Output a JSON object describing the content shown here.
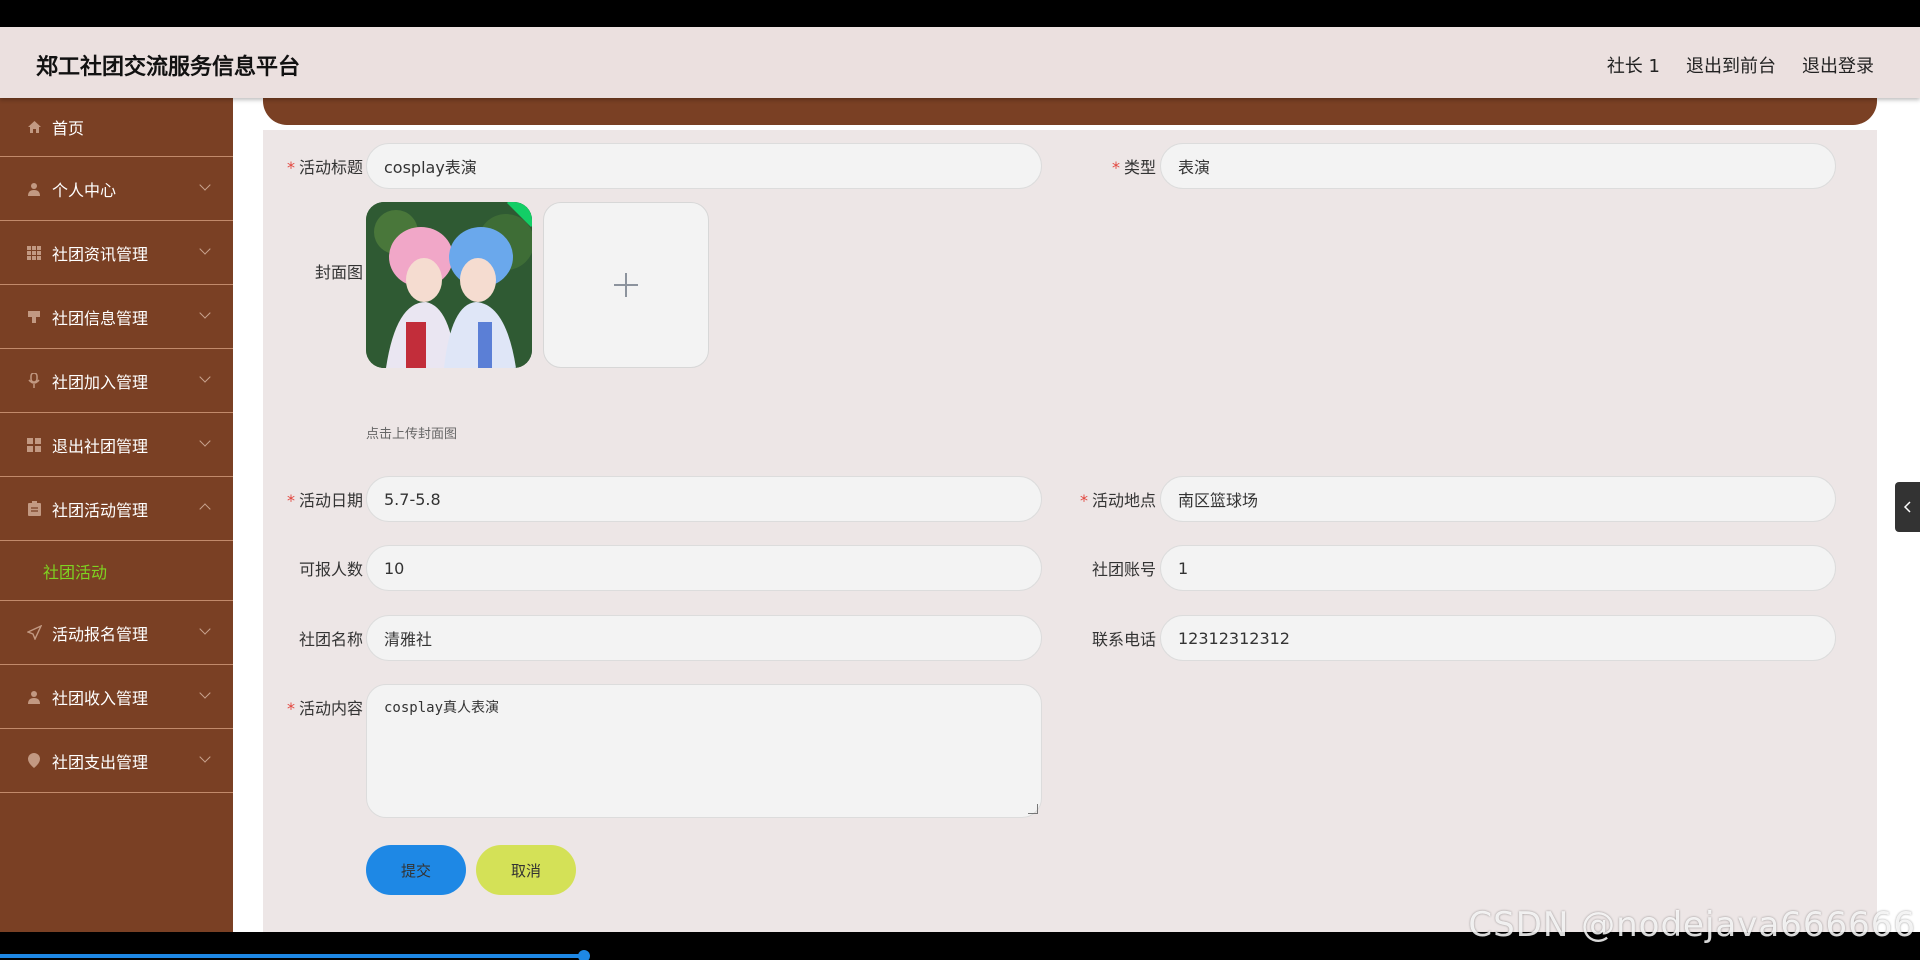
{
  "app_title": "郑工社团交流服务信息平台",
  "header_nav": [
    "社长 1",
    "退出到前台",
    "退出登录"
  ],
  "sidebar": {
    "items": [
      {
        "label": "首页",
        "icon": "home-icon"
      },
      {
        "label": "个人中心",
        "icon": "user-icon"
      },
      {
        "label": "社团资讯管理",
        "icon": "grid-icon"
      },
      {
        "label": "社团信息管理",
        "icon": "stamp-icon"
      },
      {
        "label": "社团加入管理",
        "icon": "mic-icon"
      },
      {
        "label": "退出社团管理",
        "icon": "apps-icon"
      },
      {
        "label": "社团活动管理",
        "icon": "clipboard-icon"
      },
      {
        "label": "活动报名管理",
        "icon": "send-icon"
      },
      {
        "label": "社团收入管理",
        "icon": "user-icon"
      },
      {
        "label": "社团支出管理",
        "icon": "location-icon"
      }
    ],
    "active_sub": "社团活动"
  },
  "form": {
    "activity_title": {
      "label": "活动标题",
      "value": "cosplay表演"
    },
    "type": {
      "label": "类型",
      "value": "表演"
    },
    "cover": {
      "label": "封面图",
      "hint": "点击上传封面图"
    },
    "activity_date": {
      "label": "活动日期",
      "value": "5.7-5.8"
    },
    "location": {
      "label": "活动地点",
      "value": "南区篮球场"
    },
    "capacity": {
      "label": "可报人数",
      "value": "10"
    },
    "club_account": {
      "label": "社团账号",
      "value": "1"
    },
    "club_name": {
      "label": "社团名称",
      "value": "清雅社"
    },
    "phone": {
      "label": "联系电话",
      "value": "12312312312"
    },
    "content": {
      "label": "活动内容",
      "value": "cosplay真人表演"
    },
    "required_mark": "*",
    "submit_label": "提交",
    "cancel_label": "取消"
  },
  "watermark": "CSDN @nodejava666666",
  "colors": {
    "sidebar": "#7a4024",
    "header": "#ebe0df",
    "panel": "#ede6e6",
    "submit": "#1e88e5",
    "cancel": "#d4e157",
    "active_sub": "#7ed321"
  }
}
